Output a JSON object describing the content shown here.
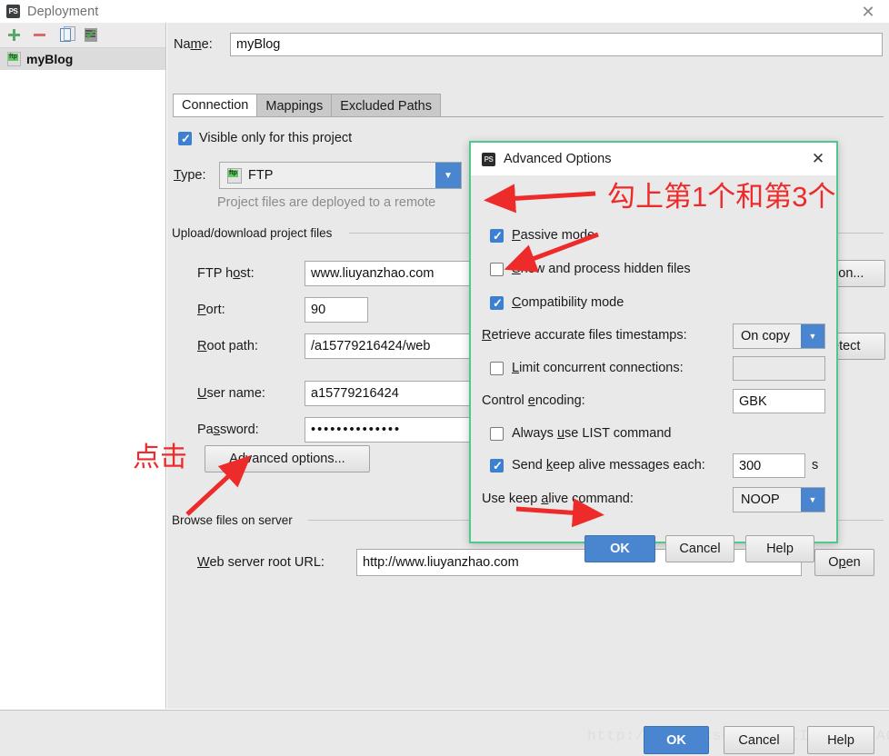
{
  "window": {
    "title": "Deployment",
    "icon": "phpstorm-icon",
    "close_label": "✕"
  },
  "sidebar": {
    "toolbar": [
      {
        "name": "add-icon",
        "label": "+"
      },
      {
        "name": "remove-icon",
        "label": "−"
      },
      {
        "name": "copy-icon",
        "label": "copy"
      },
      {
        "name": "validate-icon",
        "label": "check"
      }
    ],
    "items": [
      {
        "label": "myBlog",
        "badge": "ftp",
        "selected": true
      }
    ]
  },
  "main": {
    "name_label": "Name:",
    "name_value": "myBlog",
    "tabs": [
      {
        "label": "Connection",
        "active": true
      },
      {
        "label": "Mappings",
        "active": false
      },
      {
        "label": "Excluded Paths",
        "active": false
      }
    ],
    "visible_only_label": "Visible only for this project",
    "visible_only_checked": true,
    "type_label": "Type:",
    "type_value": "FTP",
    "type_badge": "ftp",
    "hint": "Project files are deployed to a remote",
    "upload_group": "Upload/download project files",
    "fields": [
      {
        "label": "FTP host:",
        "value": "www.liuyanzhao.com",
        "name": "ftp-host"
      },
      {
        "label": "Port:",
        "value": "90",
        "name": "port"
      },
      {
        "label": "Root path:",
        "value": "/a15779216424/web",
        "name": "root-path"
      },
      {
        "label": "User name:",
        "value": "a15779216424",
        "name": "user-name"
      },
      {
        "label": "Password:",
        "value": "••••••••••••••",
        "name": "password"
      }
    ],
    "test_connection_label": "tion...",
    "autodetect_label": "etect",
    "advanced_options_label": "Advanced options...",
    "browse_group": "Browse files on server",
    "web_url_label": "Web server root URL:",
    "web_url_value": "http://www.liuyanzhao.com",
    "open_label": "Open"
  },
  "dialog": {
    "title": "Advanced Options",
    "icon": "phpstorm-icon",
    "close_label": "✕",
    "options": [
      {
        "label": "Passive mode",
        "checked": true,
        "mnemonic": "P",
        "name": "passive-mode"
      },
      {
        "label": "Show and process hidden files",
        "checked": false,
        "mnemonic": "S",
        "name": "show-hidden-files"
      },
      {
        "label": "Compatibility mode",
        "checked": true,
        "mnemonic": "C",
        "name": "compatibility-mode"
      }
    ],
    "retrieve_label": "Retrieve accurate files timestamps:",
    "retrieve_value": "On copy",
    "limit_label": "Limit concurrent connections:",
    "limit_checked": false,
    "limit_value": "",
    "encoding_label": "Control encoding:",
    "encoding_value": "GBK",
    "list_command_label": "Always use LIST command",
    "list_command_checked": false,
    "keepalive_label": "Send keep alive messages each:",
    "keepalive_checked": true,
    "keepalive_value": "300",
    "keepalive_unit": "s",
    "keepalive_cmd_label": "Use keep alive command:",
    "keepalive_cmd_value": "NOOP",
    "buttons": {
      "ok": "OK",
      "cancel": "Cancel",
      "help": "Help"
    }
  },
  "bottom": {
    "ok": "OK",
    "cancel": "Cancel",
    "help": "Help",
    "watermark": "http://blog.csdn.net/LIU_YANZHAO"
  },
  "annotations": {
    "click_text": "点击",
    "check_text": "勾上第1个和第3个",
    "color": "#ee2b2b"
  }
}
